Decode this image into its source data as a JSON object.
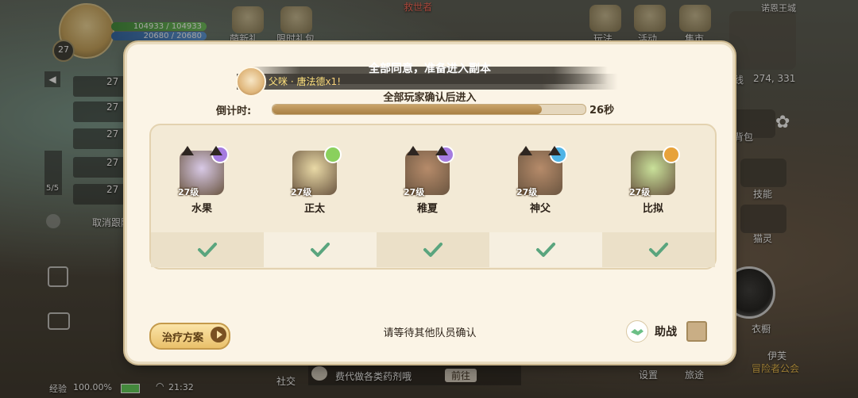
{
  "hud": {
    "player_level": "27",
    "hp_text": "104933 / 104933",
    "mp_text": "20680 / 20680",
    "top_menu": [
      "萌新礼",
      "限时礼包"
    ],
    "top_right_menu": [
      "玩法",
      "活动",
      "集市"
    ],
    "region_name": "诺恩王城",
    "coords": "274, 331",
    "line_label": "线",
    "npc_name": "救世者",
    "party_count": "5/5",
    "cancel_follow": "取消跟随",
    "side_levels": [
      "27",
      "27",
      "27",
      "27",
      "27"
    ],
    "right_menu": [
      "背包",
      "技能",
      "猫灵",
      "衣橱"
    ],
    "bottom_right": [
      "设置",
      "旅途"
    ],
    "guild_name": "伊芙",
    "guild_tag": "冒险者公会",
    "social": "社交",
    "bottom_chat": "费代做各类药剂哦",
    "goto_label": "前往",
    "exp_label": "经验",
    "exp_value": "100.00%",
    "clock": "21:32"
  },
  "dialog": {
    "title": "全部同意，准备进入副本",
    "chat_prefix": "父咪 · 唐法德",
    "chat_suffix": "x1!",
    "subtitle": "全部玩家确认后进入",
    "countdown_label": "倒计时:",
    "countdown_value": "26秒",
    "countdown_progress": 0.86,
    "members": [
      {
        "name": "水果",
        "level": "27级",
        "element_color": "#a57ce0",
        "portrait": "#d8c9e6",
        "confirmed": true
      },
      {
        "name": "正太",
        "level": "27级",
        "element_color": "#8ad05d",
        "portrait": "#e9d9a6",
        "confirmed": true
      },
      {
        "name": "稚夏",
        "level": "27级",
        "element_color": "#a57ce0",
        "portrait": "#b68b6a",
        "confirmed": true
      },
      {
        "name": "神父",
        "level": "27级",
        "element_color": "#4fb4e6",
        "portrait": "#b68b6a",
        "confirmed": true
      },
      {
        "name": "比拟",
        "level": "27级",
        "element_color": "#e7a23a",
        "portrait": "#c9e19a",
        "confirmed": true
      }
    ],
    "heal_button": "治疗方案",
    "wait_text": "请等待其他队员确认",
    "assist_label": "助战",
    "colors": {
      "check": "#5aa57e",
      "accent": "#c49a4b"
    }
  }
}
